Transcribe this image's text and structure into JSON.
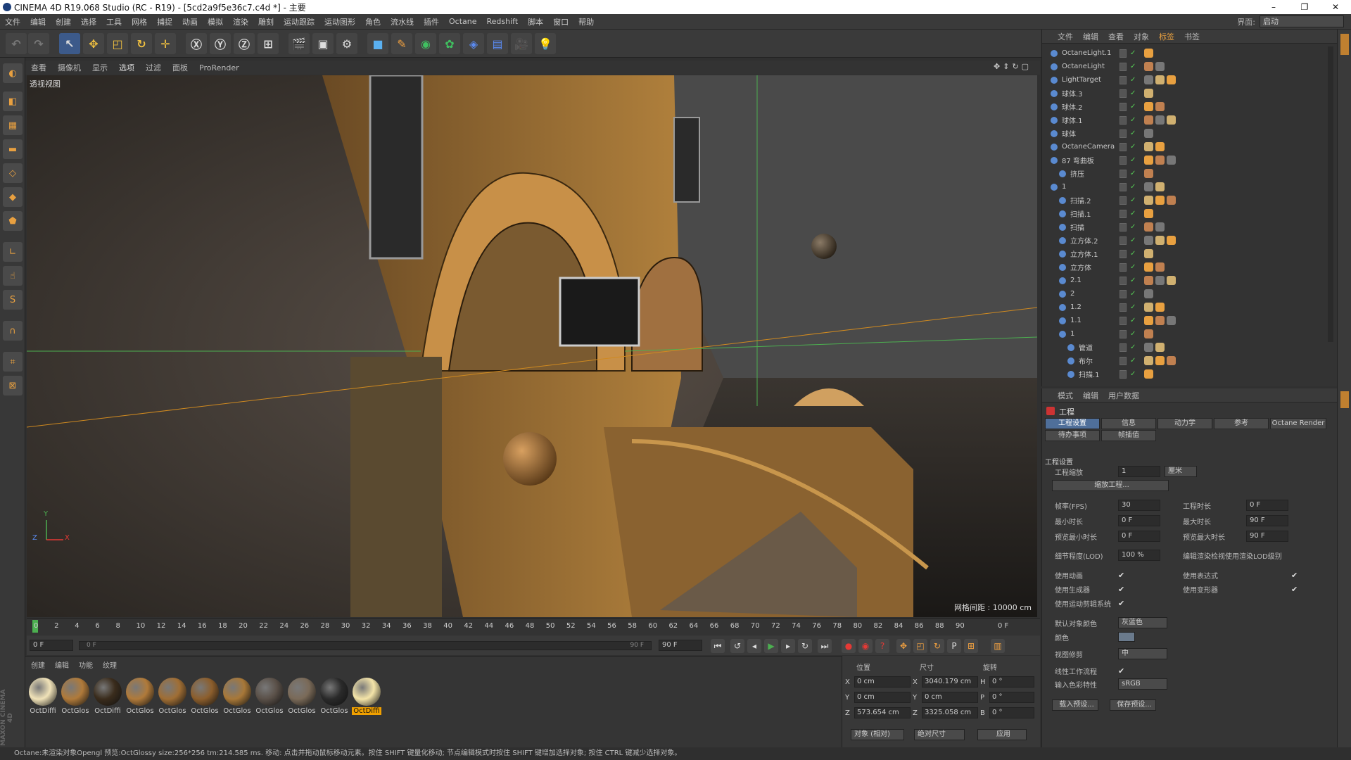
{
  "window": {
    "title": "CINEMA 4D R19.068 Studio (RC - R19) - [5cd2a9f5e36c7.c4d *] - 主要",
    "min": "–",
    "max": "❐",
    "close": "✕"
  },
  "menubar": {
    "items": [
      "文件",
      "编辑",
      "创建",
      "选择",
      "工具",
      "网格",
      "捕捉",
      "动画",
      "模拟",
      "渲染",
      "雕刻",
      "运动跟踪",
      "运动图形",
      "角色",
      "流水线",
      "插件",
      "Octane",
      "Redshift",
      "脚本",
      "窗口",
      "帮助"
    ],
    "layout_label": "界面:",
    "layout_value": "启动"
  },
  "viewport": {
    "menu": [
      "查看",
      "摄像机",
      "显示",
      "选项",
      "过滤",
      "面板",
      "ProRender"
    ],
    "label": "透视视图",
    "grid_spacing": "网格间距 : 10000 cm",
    "axis_y": "Y",
    "axis_x": "X",
    "axis_z": "Z"
  },
  "timeline": {
    "ticks": [
      "0",
      "2",
      "4",
      "6",
      "8",
      "10",
      "12",
      "14",
      "16",
      "18",
      "20",
      "22",
      "24",
      "26",
      "28",
      "30",
      "32",
      "34",
      "36",
      "38",
      "40",
      "42",
      "44",
      "46",
      "48",
      "50",
      "52",
      "54",
      "56",
      "58",
      "60",
      "62",
      "64",
      "66",
      "68",
      "70",
      "72",
      "74",
      "76",
      "78",
      "80",
      "82",
      "84",
      "86",
      "88",
      "90"
    ],
    "end_label": "0 F",
    "current": "0 F",
    "range_start": "0 F",
    "range_end": "90 F",
    "max_field": "90 F"
  },
  "materials": {
    "menu": [
      "创建",
      "编辑",
      "功能",
      "纹理"
    ],
    "items": [
      {
        "label": "OctDiffi",
        "color": "#f0e2b8"
      },
      {
        "label": "OctGlos",
        "color": "#b07a3a"
      },
      {
        "label": "OctDiffi",
        "color": "#3a2c1c"
      },
      {
        "label": "OctGlos",
        "color": "#b07a3a"
      },
      {
        "label": "OctGlos",
        "color": "#a06e34"
      },
      {
        "label": "OctGlos",
        "color": "#8c5e2c"
      },
      {
        "label": "OctGlos",
        "color": "#a87838"
      },
      {
        "label": "OctGlos",
        "color": "#5a5048"
      },
      {
        "label": "OctGlos",
        "color": "#7a6a58"
      },
      {
        "label": "OctGlos",
        "color": "#2a2a2a"
      },
      {
        "label": "OctDiffi",
        "color": "#f4e4a8"
      }
    ]
  },
  "coords": {
    "headers": [
      "位置",
      "尺寸",
      "旋转"
    ],
    "rows": [
      {
        "axis": "X",
        "pos": "0 cm",
        "size_axis": "X",
        "size": "3040.179 cm",
        "rot_axis": "H",
        "rot": "0 °"
      },
      {
        "axis": "Y",
        "pos": "0 cm",
        "size_axis": "Y",
        "size": "0 cm",
        "rot_axis": "P",
        "rot": "0 °"
      },
      {
        "axis": "Z",
        "pos": "573.654 cm",
        "size_axis": "Z",
        "size": "3325.058 cm",
        "rot_axis": "B",
        "rot": "0 °"
      }
    ],
    "mode": "对象 (相对)",
    "size_mode": "绝对尺寸",
    "apply": "应用"
  },
  "objects": {
    "menu": [
      "文件",
      "编辑",
      "查看",
      "对象",
      "标签",
      "书签"
    ],
    "rows": [
      {
        "name": "OctaneLight.1",
        "indent": 0
      },
      {
        "name": "OctaneLight",
        "indent": 0
      },
      {
        "name": "LightTarget",
        "indent": 0
      },
      {
        "name": "球体.3",
        "indent": 0
      },
      {
        "name": "球体.2",
        "indent": 0
      },
      {
        "name": "球体.1",
        "indent": 0
      },
      {
        "name": "球体",
        "indent": 0
      },
      {
        "name": "OctaneCamera",
        "indent": 0
      },
      {
        "name": "87 弯曲板",
        "indent": 0
      },
      {
        "name": "挤压",
        "indent": 1
      },
      {
        "name": "1",
        "indent": 0
      },
      {
        "name": "扫描.2",
        "indent": 1
      },
      {
        "name": "扫描.1",
        "indent": 1
      },
      {
        "name": "扫描",
        "indent": 1
      },
      {
        "name": "立方体.2",
        "indent": 1
      },
      {
        "name": "立方体.1",
        "indent": 1
      },
      {
        "name": "立方体",
        "indent": 1
      },
      {
        "name": "2.1",
        "indent": 1
      },
      {
        "name": "2",
        "indent": 1
      },
      {
        "name": "1.2",
        "indent": 1
      },
      {
        "name": "1.1",
        "indent": 1
      },
      {
        "name": "1",
        "indent": 1
      },
      {
        "name": "管道",
        "indent": 2
      },
      {
        "name": "布尔",
        "indent": 2
      },
      {
        "name": "扫描.1",
        "indent": 2
      }
    ]
  },
  "attributes": {
    "menu": [
      "模式",
      "编辑",
      "用户数据"
    ],
    "section": "工程",
    "tabs_row1": [
      "工程设置",
      "信息",
      "动力学",
      "参考",
      "Octane Render"
    ],
    "tabs_row2": [
      "待办事项",
      "帧插值"
    ],
    "group_title": "工程设置",
    "project_scale_label": "工程缩放",
    "project_scale_value": "1",
    "project_scale_unit": "厘米",
    "scale_button": "缩放工程...",
    "fps_label": "帧率(FPS)",
    "fps_value": "30",
    "project_time_label": "工程时长",
    "project_time_value": "0 F",
    "min_time_label": "最小时长",
    "min_time_value": "0 F",
    "max_time_label": "最大时长",
    "max_time_value": "90 F",
    "preview_min_label": "预览最小时长",
    "preview_min_value": "0 F",
    "preview_max_label": "预览最大时长",
    "preview_max_value": "90 F",
    "lod_label": "细节程度(LOD)",
    "lod_value": "100 %",
    "lod_render_label": "编辑渲染检视使用渲染LOD级别",
    "use_anim_label": "使用动画",
    "use_expr_label": "使用表达式",
    "use_gen_label": "使用生成器",
    "use_deform_label": "使用变形器",
    "use_motion_label": "使用运动剪辑系统",
    "default_color_label": "默认对象颜色",
    "default_color_value": "灰蓝色",
    "color_label": "颜色",
    "view_clip_label": "视图修剪",
    "view_clip_value": "中",
    "linear_label": "线性工作流程",
    "input_color_label": "输入色彩特性",
    "input_color_value": "sRGB",
    "load_preset": "载入预设...",
    "save_preset": "保存预设..."
  },
  "status": "Octane:未渲染对象Opengl 预览:OctGlossy  size:256*256  tm:214.585 ms.    移动: 点击并拖动鼠标移动元素。按住 SHIFT 键量化移动; 节点编辑模式时按住 SHIFT 键增加选择对象; 按住 CTRL 键减少选择对象。"
}
